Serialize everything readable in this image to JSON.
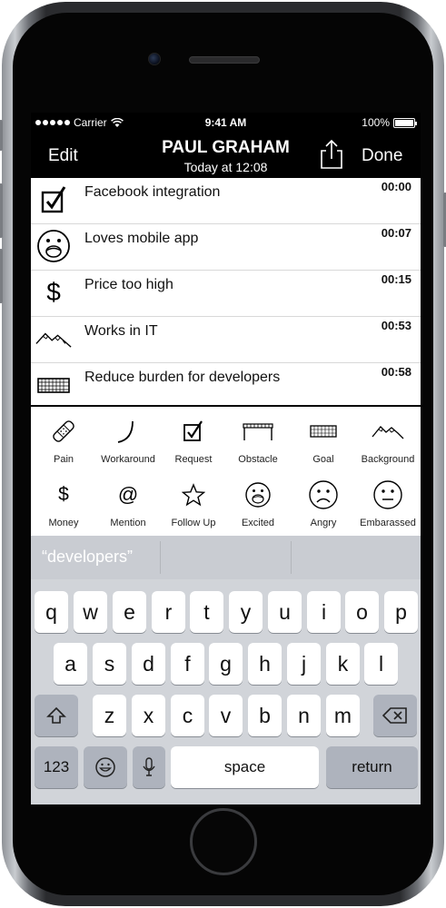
{
  "status_bar": {
    "carrier": "Carrier",
    "time": "9:41 AM",
    "battery": "100%"
  },
  "nav": {
    "left": "Edit",
    "title": "PAUL GRAHAM",
    "subtitle": "Today at 12:08",
    "share_icon": "share-icon",
    "right": "Done"
  },
  "notes": [
    {
      "label": "Facebook integration",
      "time": "00:00",
      "icon": "checkbox-icon"
    },
    {
      "label": "Loves mobile app",
      "time": "00:07",
      "icon": "excited-face-icon"
    },
    {
      "label": "Price too high",
      "time": "00:15",
      "icon": "dollar-icon"
    },
    {
      "label": "Works in IT",
      "time": "00:53",
      "icon": "mountains-icon"
    },
    {
      "label": "Reduce burden for developers",
      "time": "00:58",
      "icon": "goal-net-icon"
    }
  ],
  "categories": [
    {
      "label": "Pain",
      "icon": "bandage-icon"
    },
    {
      "label": "Workaround",
      "icon": "curve-icon"
    },
    {
      "label": "Request",
      "icon": "checkbox-icon"
    },
    {
      "label": "Obstacle",
      "icon": "hurdle-icon"
    },
    {
      "label": "Goal",
      "icon": "goal-net-icon"
    },
    {
      "label": "Background",
      "icon": "mountains-icon"
    },
    {
      "label": "Money",
      "icon": "dollar-icon"
    },
    {
      "label": "Mention",
      "icon": "at-icon"
    },
    {
      "label": "Follow Up",
      "icon": "star-icon"
    },
    {
      "label": "Excited",
      "icon": "excited-face-icon"
    },
    {
      "label": "Angry",
      "icon": "angry-face-icon"
    },
    {
      "label": "Embarassed",
      "icon": "neutral-face-icon"
    }
  ],
  "keyboard": {
    "suggestion": "“developers”",
    "row1": [
      "q",
      "w",
      "e",
      "r",
      "t",
      "y",
      "u",
      "i",
      "o",
      "p"
    ],
    "row2": [
      "a",
      "s",
      "d",
      "f",
      "g",
      "h",
      "j",
      "k",
      "l"
    ],
    "row3": [
      "z",
      "x",
      "c",
      "v",
      "b",
      "n",
      "m"
    ],
    "numbers": "123",
    "space": "space",
    "return": "return"
  }
}
